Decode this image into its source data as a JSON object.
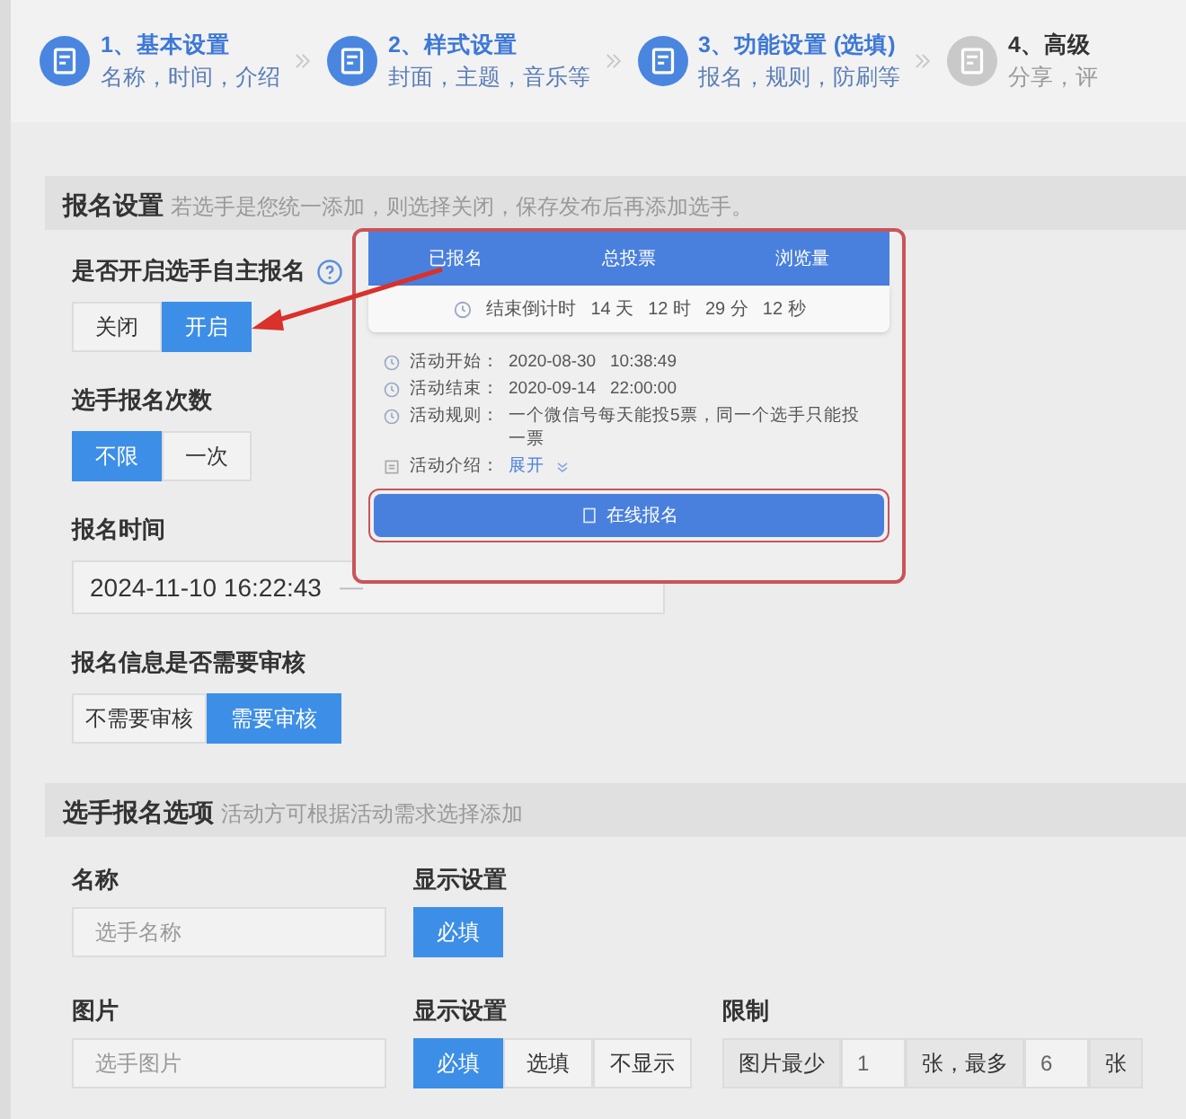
{
  "steps": [
    {
      "title": "1、基本设置",
      "subtitle": "名称，时间，介绍",
      "active": true
    },
    {
      "title": "2、样式设置",
      "subtitle": "封面，主题，音乐等",
      "active": true
    },
    {
      "title": "3、功能设置 (选填)",
      "subtitle": "报名，规则，防刷等",
      "active": true
    },
    {
      "title": "4、高级",
      "subtitle": "分享，评",
      "active": false
    }
  ],
  "signup_section": {
    "title": "报名设置",
    "hint": "若选手是您统一添加，则选择关闭，保存发布后再添加选手。",
    "settings": [
      {
        "kind": "toggle",
        "label": "是否开启选手自主报名",
        "help": true,
        "options": [
          {
            "label": "关闭",
            "selected": false
          },
          {
            "label": "开启",
            "selected": true
          }
        ]
      },
      {
        "kind": "toggle",
        "label": "选手报名次数",
        "options": [
          {
            "label": "不限",
            "selected": true
          },
          {
            "label": "一次",
            "selected": false
          }
        ]
      },
      {
        "kind": "date_range",
        "label": "报名时间",
        "start": "2024-11-10 16:22:43",
        "separator": "—"
      },
      {
        "kind": "toggle",
        "label": "报名信息是否需要审核",
        "options": [
          {
            "label": "不需要审核",
            "selected": false
          },
          {
            "label": "需要审核",
            "selected": true
          }
        ]
      }
    ]
  },
  "options_section": {
    "title": "选手报名选项",
    "hint": "活动方可根据活动需求选择添加",
    "fields": [
      {
        "label": "名称",
        "placeholder": "选手名称",
        "display_label": "显示设置",
        "display_options": [
          {
            "label": "必填",
            "selected": true
          }
        ]
      },
      {
        "label": "图片",
        "placeholder": "选手图片",
        "display_label": "显示设置",
        "display_options": [
          {
            "label": "必填",
            "selected": true
          },
          {
            "label": "选填",
            "selected": false
          },
          {
            "label": "不显示",
            "selected": false
          }
        ],
        "limit": {
          "label": "限制",
          "parts": [
            {
              "kind": "addon",
              "text": "图片最少"
            },
            {
              "kind": "input",
              "value": "1"
            },
            {
              "kind": "addon",
              "text": "张，最多"
            },
            {
              "kind": "input",
              "value": "6"
            },
            {
              "kind": "addon",
              "text": "张"
            }
          ]
        }
      }
    ]
  },
  "preview_popup": {
    "stats": [
      "已报名",
      "总投票",
      "浏览量"
    ],
    "countdown": {
      "label": "结束倒计时",
      "units": [
        "14 天",
        "12 时",
        "29 分",
        "12 秒"
      ]
    },
    "info": [
      {
        "label": "活动开始：",
        "value": "2020-08-30   10:38:49"
      },
      {
        "label": "活动结束：",
        "value": "2020-09-14   22:00:00"
      },
      {
        "label": "活动规则：",
        "value": "一个微信号每天能投5票，同一个选手只能投一票"
      }
    ],
    "intro": {
      "label": "活动介绍：",
      "link": "展开"
    },
    "button": "在线报名"
  }
}
